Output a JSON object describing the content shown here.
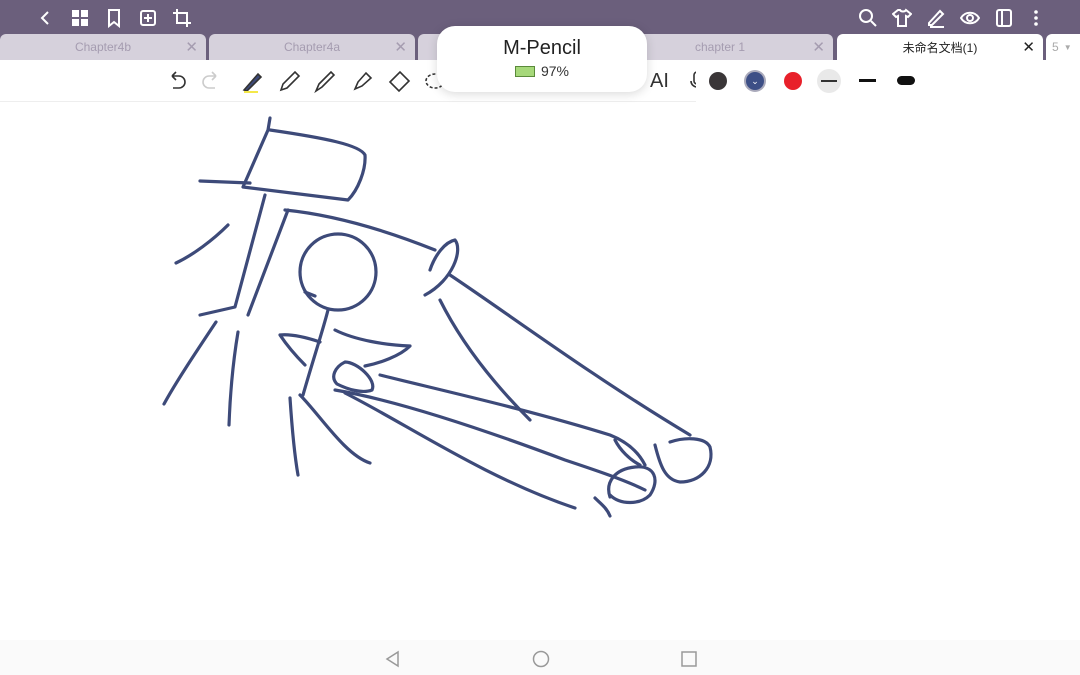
{
  "tabs": [
    {
      "label": "Chapter4b",
      "active": false
    },
    {
      "label": "Chapter4a",
      "active": false
    },
    {
      "label": "chapter 1",
      "active": false
    },
    {
      "label": "未命名文档(1)",
      "active": true
    }
  ],
  "tab_count": "5",
  "tab_close": "✕",
  "popup": {
    "device": "M-Pencil",
    "battery": "97%"
  },
  "toolbar": {
    "ai_label": "AI"
  },
  "colors": {
    "topbar": "#6b5f7c",
    "ink": "#3d4a79",
    "swatch_dark": "#3a3638",
    "swatch_blue": "#3d4f86",
    "swatch_red": "#e8202a"
  }
}
